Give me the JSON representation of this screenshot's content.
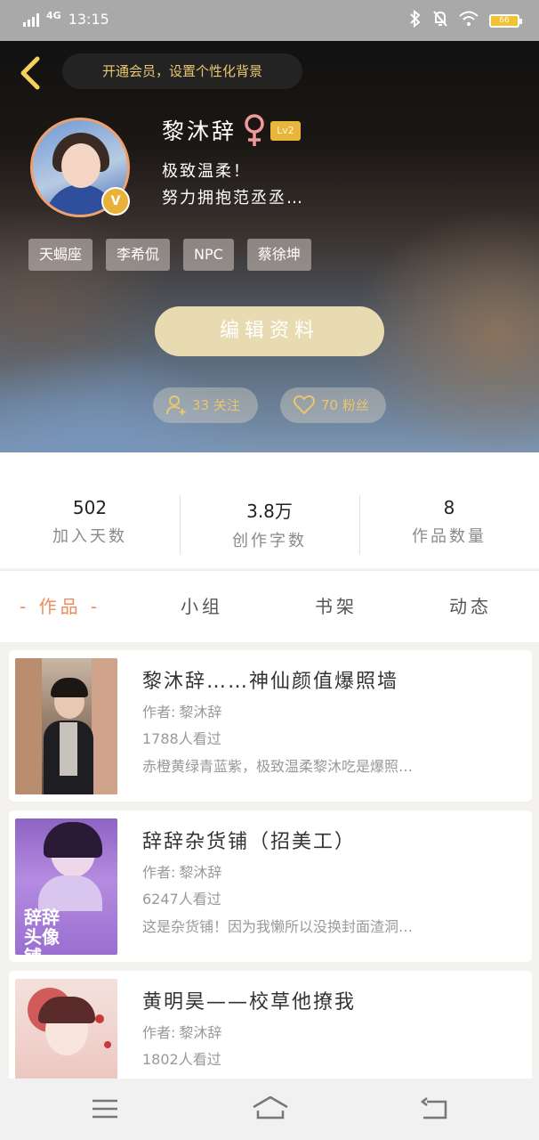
{
  "status_bar": {
    "network": "4G",
    "time": "13:15",
    "battery_level": "66"
  },
  "header": {
    "vip_prompt": "开通会员，设置个性化背景"
  },
  "profile": {
    "name": "黎沐辞",
    "level": "Lv2",
    "bio_line1": "极致温柔！",
    "bio_line2": "努力拥抱范丞丞…",
    "verified_badge": "V",
    "tags": [
      "天蝎座",
      "李希侃",
      "NPC",
      "蔡徐坤"
    ],
    "edit_label": "编辑资料",
    "following_label": "33 关注",
    "followers_label": "70 粉丝"
  },
  "stats": [
    {
      "value": "502",
      "label": "加入天数"
    },
    {
      "value": "3.8万",
      "label": "创作字数"
    },
    {
      "value": "8",
      "label": "作品数量"
    }
  ],
  "tabs": [
    {
      "label": "- 作品 -",
      "active": true
    },
    {
      "label": "小组",
      "active": false
    },
    {
      "label": "书架",
      "active": false
    },
    {
      "label": "动态",
      "active": false
    }
  ],
  "works": [
    {
      "title": "黎沐辞……神仙颜值爆照墙",
      "author_label": "作者:",
      "author": "黎沐辞",
      "views": "1788人看过",
      "desc": "赤橙黄绿青蓝紫，极致温柔黎沐吃是爆照…"
    },
    {
      "title": "辞辞杂货铺（招美工）",
      "author_label": "作者:",
      "author": "黎沐辞",
      "views": "6247人看过",
      "desc": "这是杂货铺！因为我懒所以没换封面渣洞…",
      "cover_text": "辞辞头像铺"
    },
    {
      "title": "黄明昊——校草他撩我",
      "author_label": "作者:",
      "author": "黎沐辞",
      "views": "1802人看过",
      "desc": ""
    }
  ],
  "colors": {
    "accent": "#ef8c5a",
    "gold": "#e9c66f",
    "edit_button": "#e9dbb1",
    "status_bar": "#a9a9a9"
  }
}
